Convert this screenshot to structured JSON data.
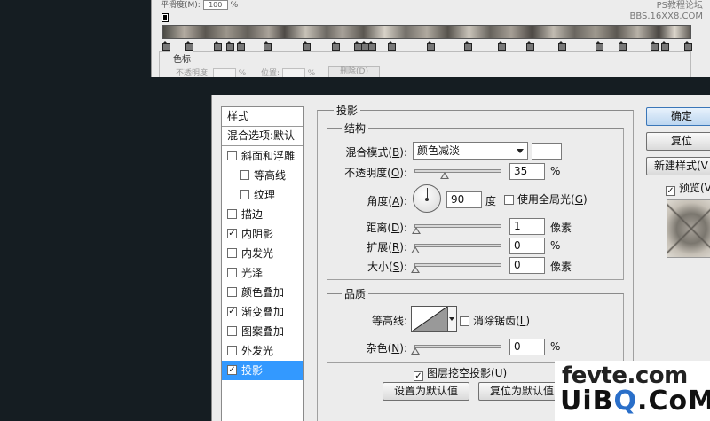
{
  "gradient_editor": {
    "smoothness_label": "平滑度(M):",
    "smoothness_value": "100",
    "smoothness_unit": "%",
    "watermark_line1": "PS教程论坛",
    "watermark_line2": "BBS.16XX8.COM",
    "color_stops_label": "色标",
    "opacity_label": "不透明度:",
    "opacity_unit": "%",
    "location_label": "位置:",
    "location_unit": "%",
    "delete_button": "删除(D)"
  },
  "style_list": {
    "header": "样式",
    "blend_options": "混合选项:默认",
    "items": [
      {
        "label": "斜面和浮雕",
        "checked": false,
        "check": ""
      },
      {
        "label": "等高线",
        "checked": false,
        "check": ""
      },
      {
        "label": "纹理",
        "checked": false,
        "check": ""
      },
      {
        "label": "描边",
        "checked": false,
        "check": ""
      },
      {
        "label": "内阴影",
        "checked": true,
        "check": "✓"
      },
      {
        "label": "内发光",
        "checked": false,
        "check": ""
      },
      {
        "label": "光泽",
        "checked": false,
        "check": ""
      },
      {
        "label": "颜色叠加",
        "checked": false,
        "check": ""
      },
      {
        "label": "渐变叠加",
        "checked": true,
        "check": "✓"
      },
      {
        "label": "图案叠加",
        "checked": false,
        "check": ""
      },
      {
        "label": "外发光",
        "checked": false,
        "check": ""
      },
      {
        "label": "投影",
        "checked": true,
        "check": "✓",
        "selected": true
      }
    ]
  },
  "drop_shadow": {
    "title": "投影",
    "structure_title": "结构",
    "blend_mode_label": "混合模式(",
    "blend_mode_key": "B",
    "blend_mode_value": "颜色减淡",
    "blend_color": "#ffffff",
    "opacity_label": "不透明度(",
    "opacity_key": "O",
    "opacity_value": "35",
    "opacity_slider": 0.35,
    "percent": "%",
    "angle_label": "角度(",
    "angle_key": "A",
    "angle_value": "90",
    "angle_unit": "度",
    "global_light_label": "使用全局光(",
    "global_light_key": "G",
    "global_light_checked": false,
    "distance_label": "距离(",
    "distance_key": "D",
    "distance_value": "1",
    "spread_label": "扩展(",
    "spread_key": "R",
    "spread_value": "0",
    "size_label": "大小(",
    "size_key": "S",
    "size_value": "0",
    "pixels_unit": "像素",
    "quality_title": "品质",
    "contour_label": "等高线:",
    "antialias_label": "消除锯齿(",
    "antialias_key": "L",
    "antialias_checked": false,
    "noise_label": "杂色(",
    "noise_key": "N",
    "noise_value": "0",
    "knockout_label": "图层挖空投影(",
    "knockout_key": "U",
    "knockout_checked": true,
    "set_default_button": "设置为默认值",
    "reset_default_button": "复位为默认值",
    "close_paren": "):",
    "close_paren_plain": ")"
  },
  "buttons": {
    "ok": "确定",
    "reset": "复位",
    "new_style": "新建样式(V",
    "preview_label": "预览(V",
    "preview_checked": true
  },
  "watermark": {
    "line1": "fevte.com",
    "line2_a": "Ui",
    "line2_b": "B",
    "line2_o": "Q",
    "line2_c": ".CoM"
  },
  "colors": {
    "background": "#151d22",
    "dialog": "#ececec",
    "selection": "#3399ff"
  }
}
